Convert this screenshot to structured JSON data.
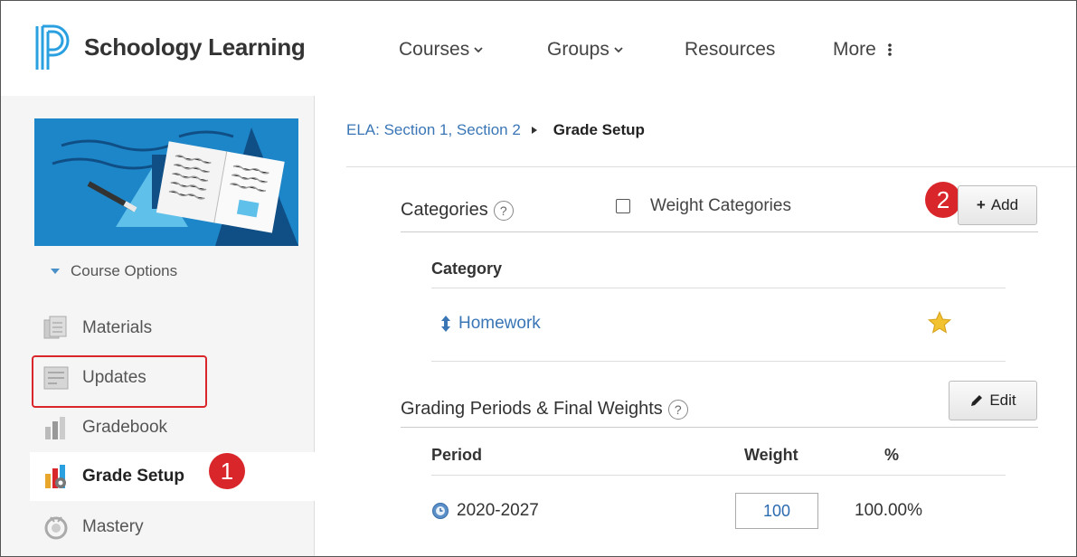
{
  "header": {
    "brand": "Schoology Learning",
    "nav": [
      {
        "label": "Courses",
        "has_chevron": true
      },
      {
        "label": "Groups",
        "has_chevron": true
      },
      {
        "label": "Resources",
        "has_chevron": false
      },
      {
        "label": "More",
        "has_dots": true
      }
    ]
  },
  "sidebar": {
    "course_options": "Course Options",
    "items": [
      {
        "label": "Materials",
        "icon": "materials-icon"
      },
      {
        "label": "Updates",
        "icon": "updates-icon"
      },
      {
        "label": "Gradebook",
        "icon": "gradebook-icon"
      },
      {
        "label": "Grade Setup",
        "icon": "grade-setup-icon",
        "active": true
      },
      {
        "label": "Mastery",
        "icon": "mastery-icon"
      }
    ]
  },
  "breadcrumb": {
    "parent": "ELA: Section 1, Section 2",
    "current": "Grade Setup"
  },
  "categories": {
    "title": "Categories",
    "help": "?",
    "weight_label": "Weight Categories",
    "add_label": "Add",
    "column": "Category",
    "rows": [
      {
        "name": "Homework",
        "starred": true
      }
    ]
  },
  "grading_periods": {
    "title": "Grading Periods & Final Weights",
    "help": "?",
    "edit_label": "Edit",
    "columns": {
      "period": "Period",
      "weight": "Weight",
      "pct": "%"
    },
    "rows": [
      {
        "name": "2020-2027",
        "weight": "100",
        "pct": "100.00%"
      }
    ]
  },
  "callouts": {
    "one": "1",
    "two": "2"
  },
  "colors": {
    "accent": "#3a76b6",
    "callout": "#d9262b",
    "brand_blue": "#1d86c8"
  }
}
